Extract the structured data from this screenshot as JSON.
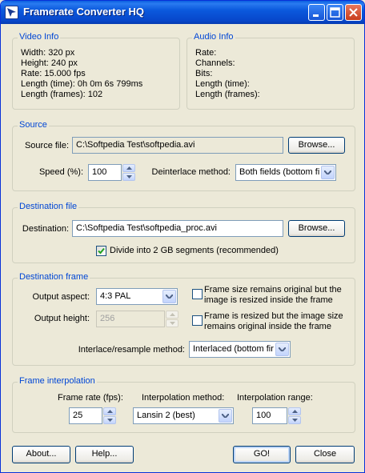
{
  "window": {
    "title": "Framerate Converter HQ"
  },
  "video_info": {
    "title": "Video Info",
    "lines": [
      "Width: 320 px",
      "Height: 240 px",
      "Rate: 15.000 fps",
      "Length (time): 0h 0m 6s 799ms",
      "Length (frames): 102"
    ]
  },
  "audio_info": {
    "title": "Audio Info",
    "lines": [
      "Rate:",
      "Channels:",
      "Bits:",
      "Length (time):",
      "Length (frames):"
    ]
  },
  "source": {
    "title": "Source",
    "file_label": "Source file:",
    "file_value": "C:\\Softpedia Test\\softpedia.avi",
    "browse_label": "Browse...",
    "speed_label": "Speed (%):",
    "speed_value": "100",
    "deinterlace_label": "Deinterlace method:",
    "deinterlace_value": "Both fields (bottom fir"
  },
  "destination_file": {
    "title": "Destination file",
    "dest_label": "Destination:",
    "dest_value": "C:\\Softpedia Test\\softpedia_proc.avi",
    "browse_label": "Browse...",
    "divide_label": "Divide into 2 GB segments (recommended)",
    "divide_checked": true
  },
  "destination_frame": {
    "title": "Destination frame",
    "aspect_label": "Output aspect:",
    "aspect_value": "4:3 PAL",
    "height_label": "Output height:",
    "height_value": "256",
    "option1_label_line1": "Frame size remains original but the",
    "option1_label_line2": "image is resized inside the frame",
    "option2_label_line1": "Frame is resized but the image size",
    "option2_label_line2": "remains original inside the frame",
    "interlace_label": "Interlace/resample method:",
    "interlace_value": "Interlaced (bottom fir"
  },
  "frame_interpolation": {
    "title": "Frame interpolation",
    "rate_label": "Frame rate (fps):",
    "rate_value": "25",
    "method_label": "Interpolation method:",
    "method_value": "Lansin 2 (best)",
    "range_label": "Interpolation range:",
    "range_value": "100"
  },
  "buttons": {
    "about": "About...",
    "help": "Help...",
    "go": "GO!",
    "close": "Close"
  },
  "colors": {
    "title_bar": "#0a5fe0",
    "group_title": "#0046d5",
    "face": "#ece9d8"
  }
}
